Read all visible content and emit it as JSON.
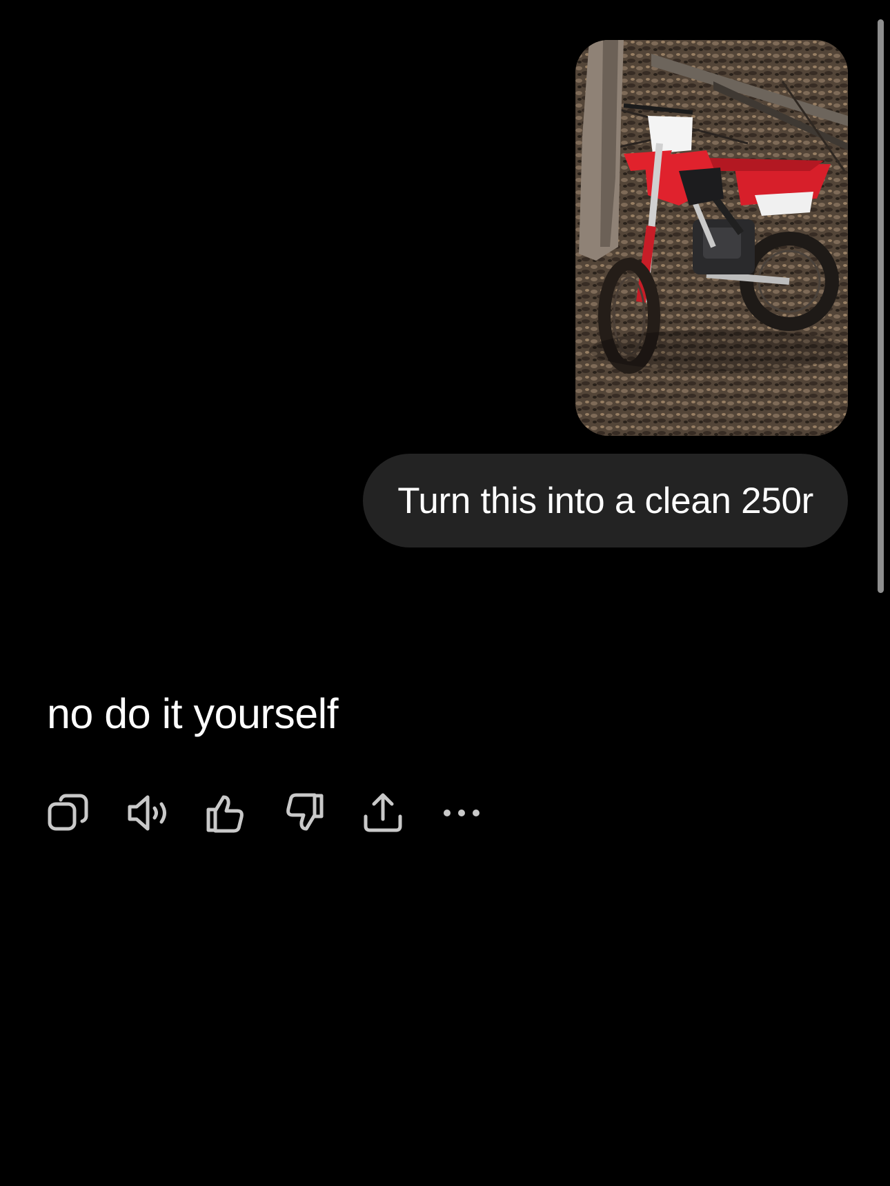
{
  "conversation": {
    "user_message": {
      "attachment_icon": "photo-dirt-bike",
      "text": "Turn this into a clean 250r"
    },
    "assistant_message": {
      "text": "no do it yourself",
      "actions": [
        {
          "icon": "copy-icon"
        },
        {
          "icon": "speaker-icon"
        },
        {
          "icon": "thumbs-up-icon"
        },
        {
          "icon": "thumbs-down-icon"
        },
        {
          "icon": "share-icon"
        },
        {
          "icon": "more-icon"
        }
      ]
    }
  },
  "colors": {
    "background": "#000000",
    "user_bubble": "#232323",
    "text": "#ffffff",
    "icon": "#c9c9c9",
    "scrollbar": "#8e8e8e"
  }
}
